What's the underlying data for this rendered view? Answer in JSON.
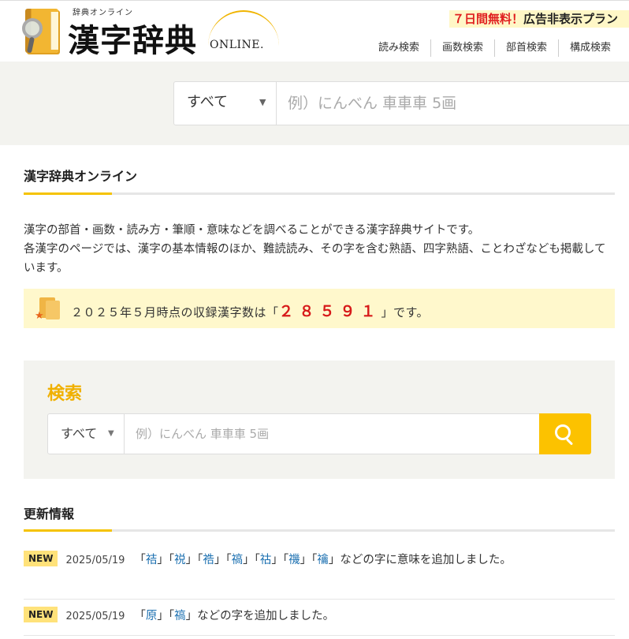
{
  "header": {
    "logo_sub": "辞典オンライン",
    "logo_main": "漢字辞典",
    "logo_online": "ONLINE.",
    "promo_red": "７日間無料！",
    "promo_dark": "広告非表示プラン",
    "nav": [
      "読み検索",
      "画数検索",
      "部首検索",
      "構成検索"
    ]
  },
  "top_search": {
    "select_value": "すべて",
    "placeholder": "例）にんべん 車車車 5画"
  },
  "intro_section": {
    "title": "漢字辞典オンライン",
    "paragraph_1": "漢字の部首・画数・読み方・筆順・意味などを調べることができる漢字辞典サイトです。",
    "paragraph_2": "各漢字のページでは、漢字の基本情報のほか、難読読み、その字を含む熟語、四字熟語、ことわざなども掲載しています。"
  },
  "count": {
    "prefix": "２０２５年５月時点の収録漢字数は「",
    "number": "２８５９１",
    "suffix": "」です。"
  },
  "search_panel": {
    "title": "検索",
    "select_value": "すべて",
    "placeholder": "例）にんべん 車車車 5画"
  },
  "news_section": {
    "title": "更新情報",
    "items": [
      {
        "badge": "NEW",
        "date": "2025/05/19",
        "kanji": [
          "祮",
          "祱",
          "祰",
          "禞",
          "祜",
          "禨",
          "禴"
        ],
        "text": "などの字に意味を追加しました。"
      },
      {
        "badge": "NEW",
        "date": "2025/05/19",
        "kanji": [
          "原",
          "禞"
        ],
        "text": "などの字を追加しました。"
      }
    ]
  }
}
